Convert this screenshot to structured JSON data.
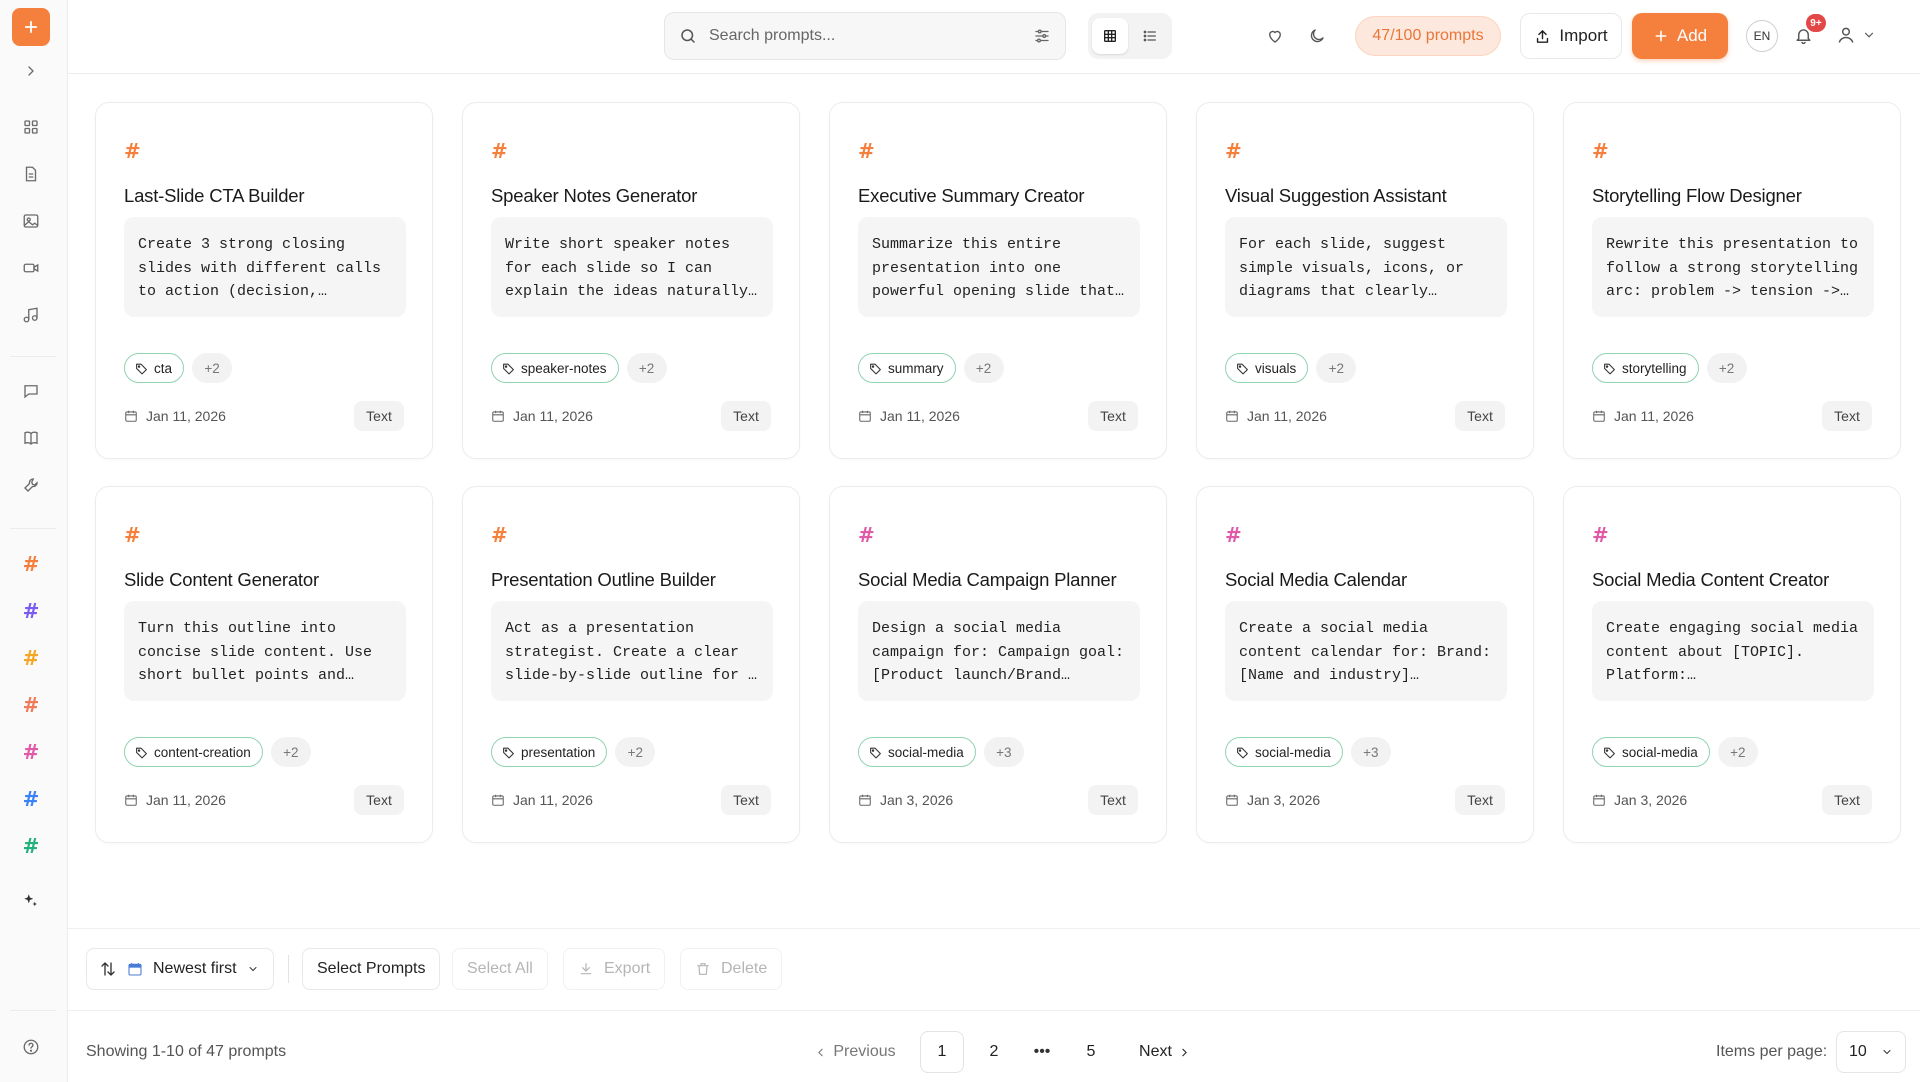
{
  "topbar": {
    "search_placeholder": "Search prompts...",
    "quota": "47/100 prompts",
    "import_label": "Import",
    "add_label": "Add",
    "language": "EN",
    "notification_badge": "9+"
  },
  "sidebar": {
    "icons": [
      "plus-icon",
      "chevron-right-icon",
      "grid-icon",
      "document-icon",
      "image-icon",
      "video-icon",
      "music-icon",
      "chat-icon",
      "book-icon",
      "wrench-icon",
      "sparkles-icon",
      "help-icon"
    ],
    "hash_colors": [
      "#f5803e",
      "#7b5cf0",
      "#f5a623",
      "#f07a5a",
      "#e05aa8",
      "#3b82f6",
      "#22b07d"
    ]
  },
  "cards": [
    {
      "title": "Last-Slide CTA Builder",
      "preview": "Create 3 strong closing\nslides with different calls\nto action (decision,…",
      "tag": "cta",
      "more": "+2",
      "date": "Jan 11, 2026",
      "type": "Text",
      "hash_color": "#f5803e"
    },
    {
      "title": "Speaker Notes Generator",
      "preview": "Write short speaker notes\nfor each slide so I can\nexplain the ideas naturally…",
      "tag": "speaker-notes",
      "more": "+2",
      "date": "Jan 11, 2026",
      "type": "Text",
      "hash_color": "#f5803e"
    },
    {
      "title": "Executive Summary Creator",
      "preview": "Summarize this entire\npresentation into one\npowerful opening slide that…",
      "tag": "summary",
      "more": "+2",
      "date": "Jan 11, 2026",
      "type": "Text",
      "hash_color": "#f5803e"
    },
    {
      "title": "Visual Suggestion Assistant",
      "preview": "For each slide, suggest\nsimple visuals, icons, or\ndiagrams that clearly…",
      "tag": "visuals",
      "more": "+2",
      "date": "Jan 11, 2026",
      "type": "Text",
      "hash_color": "#f5803e"
    },
    {
      "title": "Storytelling Flow Designer",
      "preview": "Rewrite this presentation to\nfollow a strong storytelling\narc: problem -> tension ->…",
      "tag": "storytelling",
      "more": "+2",
      "date": "Jan 11, 2026",
      "type": "Text",
      "hash_color": "#f5803e"
    },
    {
      "title": "Slide Content Generator",
      "preview": "Turn this outline into\nconcise slide content. Use\nshort bullet points and…",
      "tag": "content-creation",
      "more": "+2",
      "date": "Jan 11, 2026",
      "type": "Text",
      "hash_color": "#f5803e"
    },
    {
      "title": "Presentation Outline Builder",
      "preview": "Act as a presentation\nstrategist. Create a clear\nslide-by-slide outline for …",
      "tag": "presentation",
      "more": "+2",
      "date": "Jan 11, 2026",
      "type": "Text",
      "hash_color": "#f5803e"
    },
    {
      "title": "Social Media Campaign Planner",
      "preview": "Design a social media\ncampaign for: Campaign goal:\n[Product launch/Brand…",
      "tag": "social-media",
      "more": "+3",
      "date": "Jan 3, 2026",
      "type": "Text",
      "hash_color": "#e05aa8"
    },
    {
      "title": "Social Media Calendar",
      "preview": "Create a social media\ncontent calendar for: Brand:\n[Name and industry]…",
      "tag": "social-media",
      "more": "+3",
      "date": "Jan 3, 2026",
      "type": "Text",
      "hash_color": "#e05aa8"
    },
    {
      "title": "Social Media Content Creator",
      "preview": "Create engaging social media\ncontent about [TOPIC].\nPlatform:…",
      "tag": "social-media",
      "more": "+2",
      "date": "Jan 3, 2026",
      "type": "Text",
      "hash_color": "#e05aa8"
    }
  ],
  "toolbar": {
    "sort_label": "Newest first",
    "select_prompts": "Select Prompts",
    "select_all": "Select All",
    "export": "Export",
    "delete": "Delete"
  },
  "pagination": {
    "showing": "Showing 1-10 of 47 prompts",
    "previous": "Previous",
    "pages": [
      "1",
      "2",
      "•••",
      "5"
    ],
    "current_page": "1",
    "next": "Next",
    "items_per_page_label": "Items per page:",
    "items_per_page": "10"
  },
  "colors": {
    "accent": "#f5803e",
    "tag_border": "#8fd3b0",
    "badge": "#e34848"
  }
}
